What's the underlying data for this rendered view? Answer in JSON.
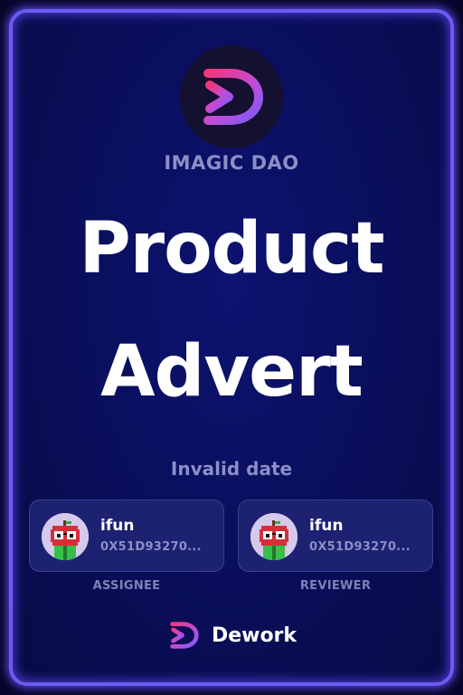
{
  "dao": {
    "name": "IMAGIC DAO",
    "logo_icon": "dework-d-icon"
  },
  "task": {
    "title_line1": "Product",
    "title_line2": "Advert",
    "date": "Invalid date"
  },
  "assignee": {
    "name": "ifun",
    "address": "0X51D93270...",
    "role": "ASSIGNEE",
    "avatar_icon": "pixel-apple-avatar-icon"
  },
  "reviewer": {
    "name": "ifun",
    "address": "0X51D93270...",
    "role": "REVIEWER",
    "avatar_icon": "pixel-apple-avatar-icon"
  },
  "footer": {
    "brand": "Dework",
    "logo_icon": "dework-d-icon"
  },
  "colors": {
    "accent_pink": "#e5397c",
    "accent_purple": "#8b5cf6",
    "border_glow": "#6d5bf0",
    "background": "#0a0f5e"
  }
}
